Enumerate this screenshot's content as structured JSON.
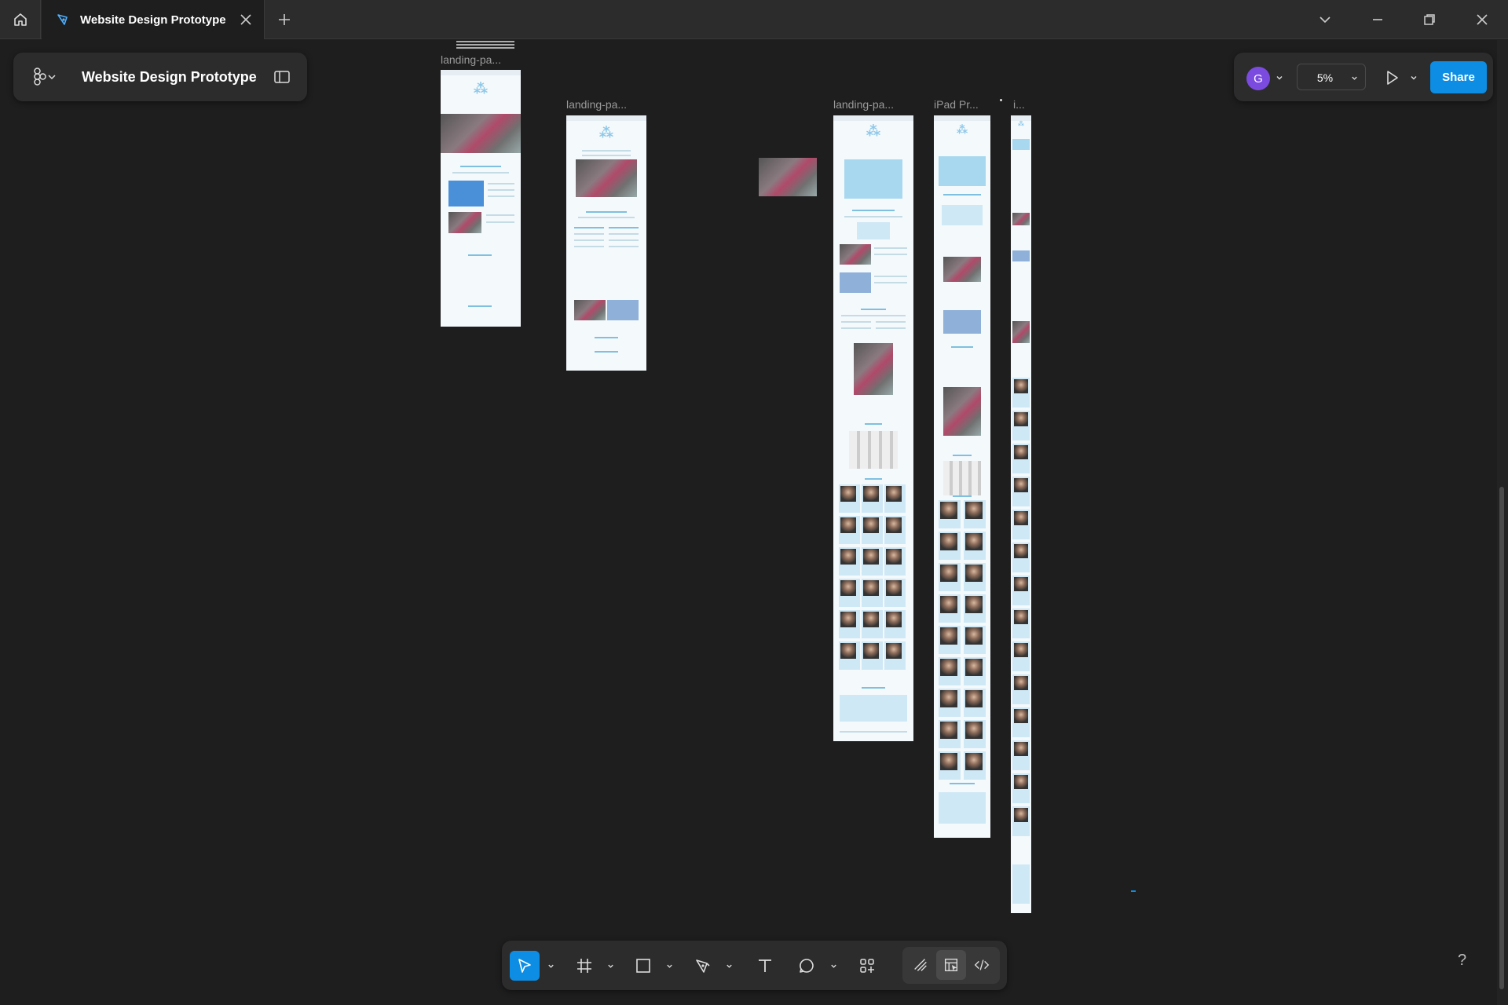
{
  "window": {
    "tab_title": "Website Design Prototype",
    "colors": {
      "accent": "#0d8de3",
      "avatar": "#7b4be0",
      "chrome": "#2c2c2c",
      "canvas": "#1e1e1e"
    }
  },
  "file_panel": {
    "title": "Website Design Prototype",
    "icons": [
      "figma-logo-icon",
      "chevron-down-icon",
      "sidebar-toggle-icon"
    ]
  },
  "collab": {
    "avatar_initial": "G",
    "zoom": "5%",
    "share_label": "Share"
  },
  "canvas": {
    "frames": [
      {
        "label": "landing-pa..."
      },
      {
        "label": "landing-pa..."
      },
      {
        "label": "landing-pa..."
      },
      {
        "label": "iPad Pr..."
      },
      {
        "label": "i..."
      }
    ]
  },
  "toolbar": {
    "tools": [
      "move-tool",
      "frame-tool",
      "rectangle-tool",
      "pen-tool",
      "text-tool",
      "comment-tool",
      "actions-tool",
      "draw-mode",
      "design-mode",
      "dev-mode"
    ]
  },
  "help_label": "?"
}
